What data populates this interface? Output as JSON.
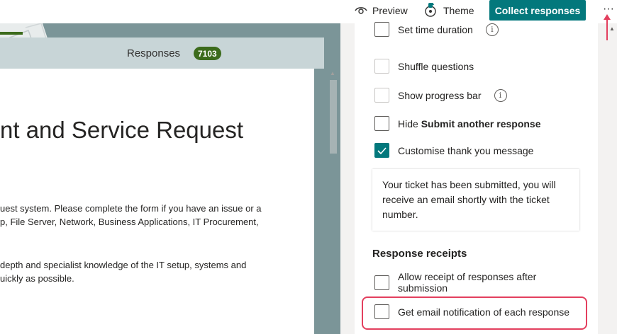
{
  "topbar": {
    "preview_label": "Preview",
    "theme_label": "Theme",
    "collect_label": "Collect responses",
    "more_label": "···"
  },
  "preview_pane": {
    "responses_label": "Responses",
    "responses_count": "7103",
    "form_title": "nt and Service Request",
    "paragraphs": [
      "uest system.  Please complete the form if you have an issue or a",
      "p, File Server, Network, Business Applications, IT Procurement,",
      "depth and specialist knowledge of the IT setup, systems and",
      "uickly as possible."
    ]
  },
  "settings": {
    "set_time_duration": "Set time duration",
    "shuffle_questions": "Shuffle questions",
    "show_progress_bar": "Show progress bar",
    "hide_prefix": "Hide ",
    "hide_bold": "Submit another response",
    "customise_thank_you": "Customise thank you message",
    "thank_you_message": "Your ticket has been submitted, you will receive an email shortly with the ticket number.",
    "response_receipts_heading": "Response receipts",
    "allow_receipt": "Allow receipt of responses after submission",
    "email_notification": "Get email notification of each response",
    "info_glyph": "i"
  },
  "colors": {
    "accent": "#03787c",
    "badge": "#3c6b1c",
    "annotation": "#e33f5e"
  }
}
